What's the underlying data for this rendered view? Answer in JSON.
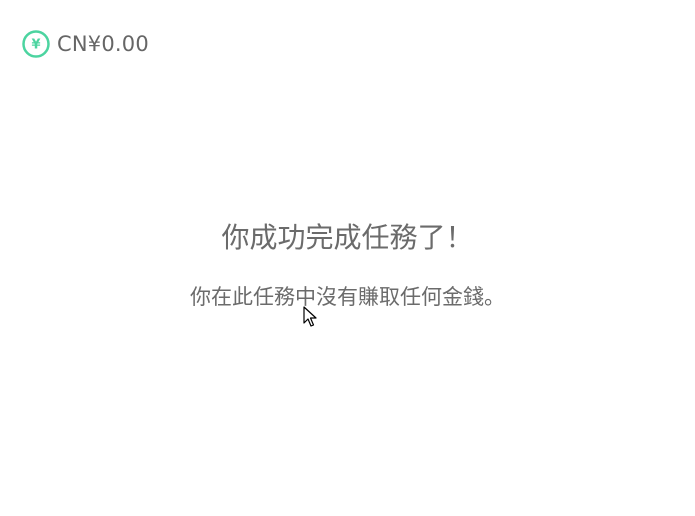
{
  "balance": {
    "amount": "CN¥0.00",
    "icon": "yen-coin-icon",
    "icon_symbol": "¥",
    "accent_color": "#4cd4a0"
  },
  "message": {
    "title": "你成功完成任務了！",
    "subtitle": "你在此任務中沒有賺取任何金錢。"
  }
}
